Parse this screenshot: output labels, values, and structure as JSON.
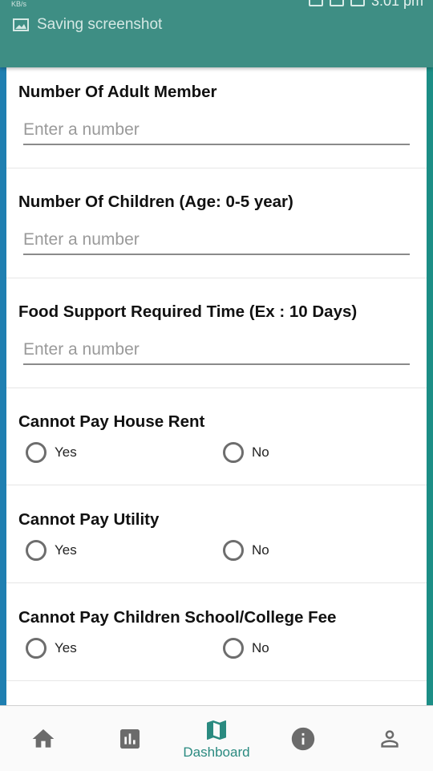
{
  "status_bar": {
    "speed_unit": "KB/s",
    "notification_text": "Saving screenshot",
    "time": "3:01 pm"
  },
  "form": {
    "adult_members": {
      "label": "Number Of Adult Member",
      "placeholder": "Enter a number"
    },
    "children": {
      "label": "Number Of Children (Age: 0-5 year)",
      "placeholder": "Enter a number"
    },
    "food_support": {
      "label": "Food Support Required Time (Ex : 10 Days)",
      "placeholder": "Enter a number"
    },
    "house_rent": {
      "label": "Cannot Pay House Rent",
      "yes": "Yes",
      "no": "No"
    },
    "utility": {
      "label": "Cannot Pay Utility",
      "yes": "Yes",
      "no": "No"
    },
    "school_fee": {
      "label": "Cannot Pay Children School/College Fee",
      "yes": "Yes",
      "no": "No"
    }
  },
  "bottom_nav": {
    "items": [
      {
        "icon": "home-icon",
        "label": ""
      },
      {
        "icon": "bar-chart-icon",
        "label": ""
      },
      {
        "icon": "map-icon",
        "label": "Dashboard"
      },
      {
        "icon": "info-icon",
        "label": ""
      },
      {
        "icon": "person-icon",
        "label": ""
      }
    ],
    "active_color": "#2a8a80",
    "inactive_color": "#6b6b6b"
  },
  "colors": {
    "app_bar": "#3e8e84",
    "left_border": "#1f7fb1",
    "right_border": "#1c8e86"
  }
}
